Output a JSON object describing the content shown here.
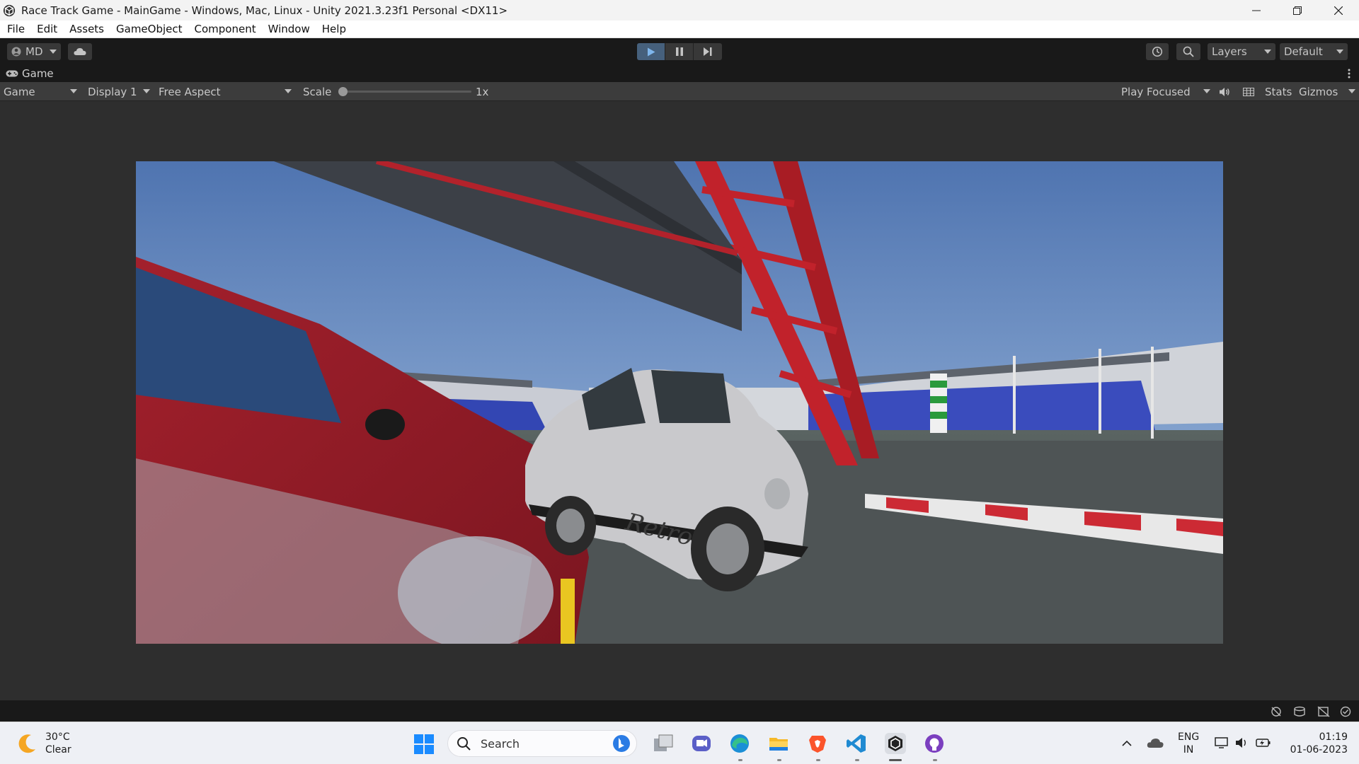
{
  "window": {
    "title": "Race Track Game - MainGame - Windows, Mac, Linux - Unity 2021.3.23f1 Personal <DX11>",
    "minimize_icon": "minimize-icon",
    "restore_icon": "restore-icon",
    "close_icon": "close-icon"
  },
  "menu": {
    "items": [
      "File",
      "Edit",
      "Assets",
      "GameObject",
      "Component",
      "Window",
      "Help"
    ]
  },
  "toolbar": {
    "account_label": "MD",
    "layers_label": "Layers",
    "layout_label": "Default"
  },
  "game_tab": {
    "label": "Game"
  },
  "game_bar": {
    "view_select": "Game",
    "display_select": "Display 1",
    "aspect_select": "Free Aspect",
    "scale_label": "Scale",
    "scale_value": 0,
    "scale_text": "1x",
    "play_mode": "Play Focused",
    "stats_label": "Stats",
    "gizmos_label": "Gizmos"
  },
  "scene": {
    "car_decal": "Retro"
  },
  "taskbar": {
    "weather_temp": "30°C",
    "weather_desc": "Clear",
    "search_placeholder": "Search",
    "lang_top": "ENG",
    "lang_bottom": "IN",
    "time": "01:19",
    "date": "01-06-2023"
  },
  "colors": {
    "accent_play": "#46607c",
    "editor_bg": "#282828",
    "toolbar_bg": "#191919"
  }
}
